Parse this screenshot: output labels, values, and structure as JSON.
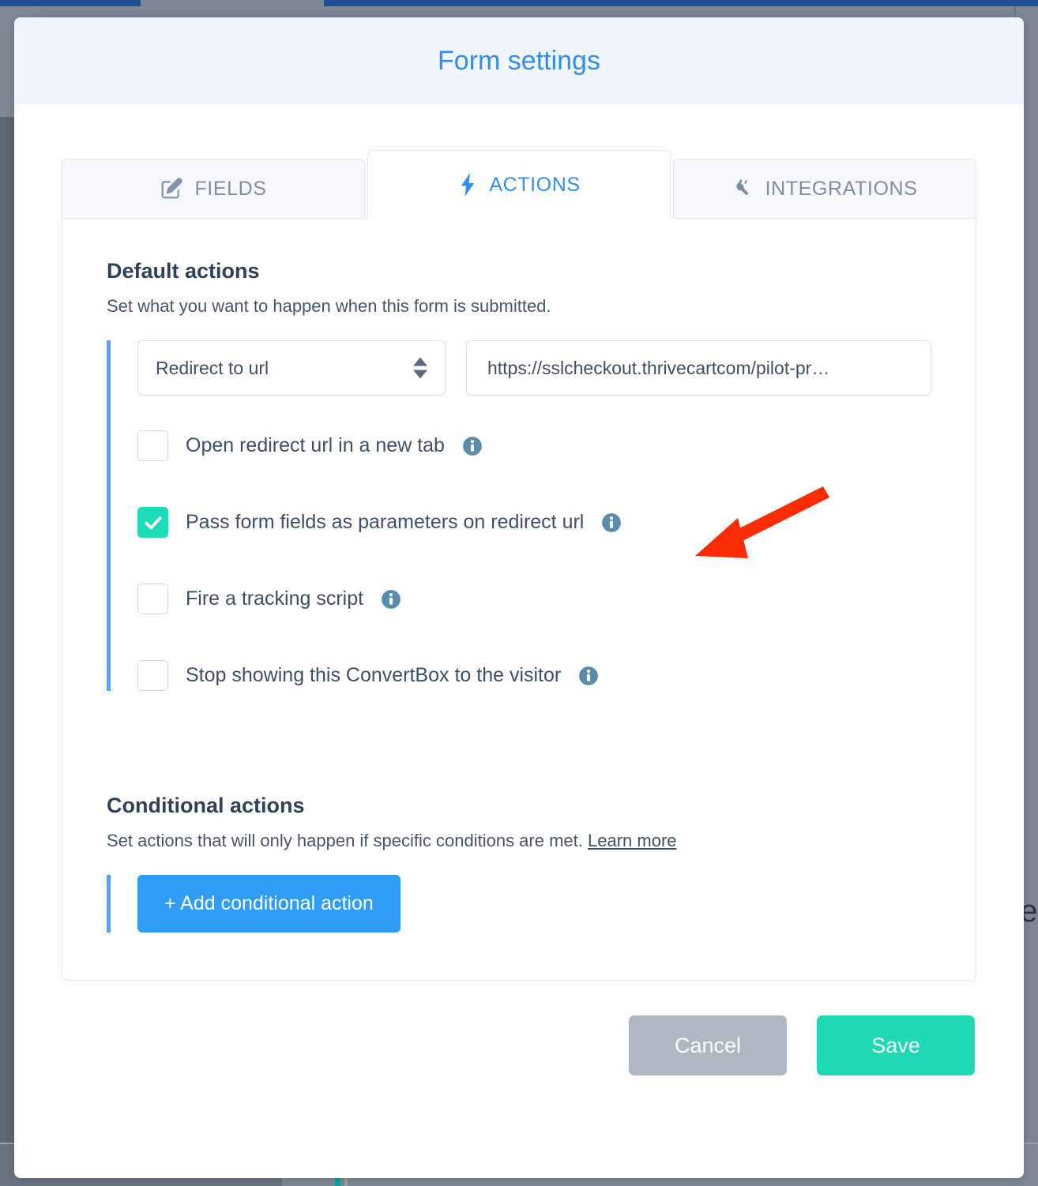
{
  "modal": {
    "title": "Form settings"
  },
  "tabs": [
    {
      "label": "FIELDS",
      "icon": "pencil-square-icon",
      "active": false
    },
    {
      "label": "ACTIONS",
      "icon": "lightning-bolt-icon",
      "active": true
    },
    {
      "label": "INTEGRATIONS",
      "icon": "plug-icon",
      "active": false
    }
  ],
  "default_actions": {
    "title": "Default actions",
    "subtitle": "Set what you want to happen when this form is submitted.",
    "action_select": {
      "value": "Redirect to url",
      "options": [
        "Redirect to url"
      ]
    },
    "url_field": {
      "value": "https://sslcheckout.thrivecartcom/pilot-pr…",
      "placeholder": "https://"
    },
    "checkboxes": [
      {
        "label": "Open redirect url in a new tab",
        "checked": false,
        "info": "info-icon"
      },
      {
        "label": "Pass form fields as parameters on redirect url",
        "checked": true,
        "info": "info-icon"
      },
      {
        "label": "Fire a tracking script",
        "checked": false,
        "info": "info-icon"
      },
      {
        "label": "Stop showing this ConvertBox to the visitor",
        "checked": false,
        "info": "info-icon"
      }
    ]
  },
  "conditional_actions": {
    "title": "Conditional actions",
    "subtitle": "Set actions that will only happen if specific conditions are met.",
    "learn_more": "Learn more",
    "add_button": "+ Add conditional action"
  },
  "footer": {
    "cancel_label": "Cancel",
    "save_label": "Save"
  },
  "annotation": {
    "arrow": "red-arrow-pointing-left"
  },
  "background": {
    "partial_text": "re"
  },
  "colors": {
    "title_blue": "#2f8df5",
    "accent_blue": "#4da6f5",
    "checkbox_teal": "#1fdcb8",
    "save_teal": "#20d9b4",
    "cancel_gray": "#aeb8c2",
    "info_icon_blue": "#5b8cae",
    "arrow_red": "#f92c06",
    "header_bg": "#f1f5fd"
  }
}
